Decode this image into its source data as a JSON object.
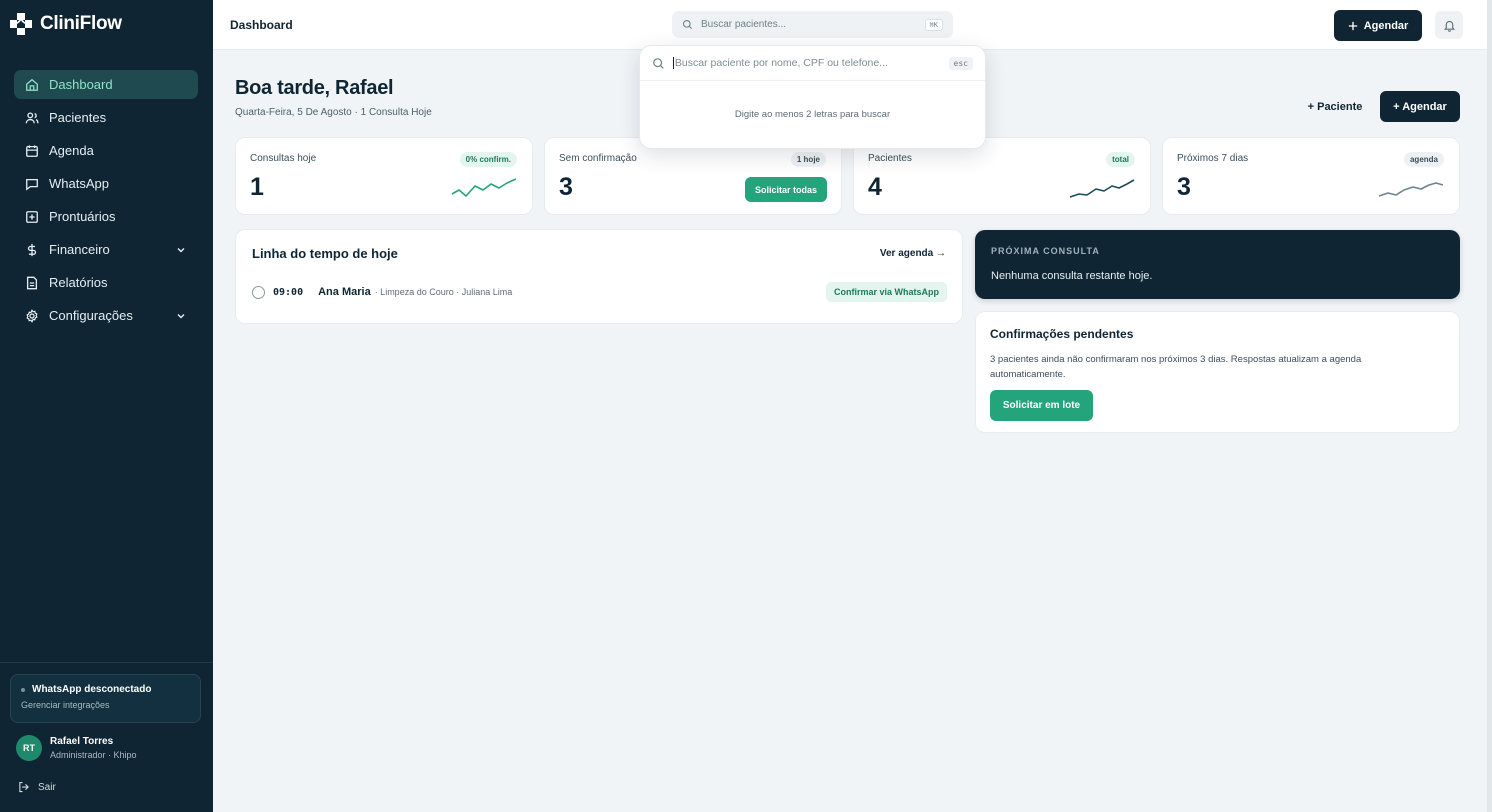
{
  "brand": {
    "name": "CliniFlow"
  },
  "sidebar": {
    "items": [
      {
        "label": "Dashboard",
        "icon": "home-icon"
      },
      {
        "label": "Pacientes",
        "icon": "users-icon"
      },
      {
        "label": "Agenda",
        "icon": "calendar-icon"
      },
      {
        "label": "WhatsApp",
        "icon": "chat-icon"
      },
      {
        "label": "Prontuários",
        "icon": "plus-square-icon"
      },
      {
        "label": "Financeiro",
        "icon": "dollar-icon"
      },
      {
        "label": "Relatórios",
        "icon": "file-icon"
      },
      {
        "label": "Configurações",
        "icon": "gear-icon"
      }
    ],
    "whatsapp_status": {
      "title": "WhatsApp desconectado",
      "link": "Gerenciar integrações"
    },
    "user": {
      "initials": "RT",
      "name": "Rafael Torres",
      "role": "Administrador · Khipo"
    },
    "logout": "Sair"
  },
  "topbar": {
    "breadcrumb": "Dashboard",
    "search_placeholder": "Buscar pacientes...",
    "search_shortcut": "⌘K",
    "agendar_label": "Agendar"
  },
  "header": {
    "greeting": "Boa tarde, Rafael",
    "subtitle": "Quarta-Feira, 5 De Agosto · 1 Consulta Hoje",
    "paciente_label": "+ Paciente",
    "agendar_label": "+ Agendar"
  },
  "stats": [
    {
      "label": "Consultas hoje",
      "value": "1",
      "badge": "0% confirm."
    },
    {
      "label": "Sem confirmação",
      "value": "3",
      "badge": "1 hoje",
      "action": "Solicitar todas"
    },
    {
      "label": "Pacientes",
      "value": "4",
      "badge": "total"
    },
    {
      "label": "Próximos 7 dias",
      "value": "3",
      "badge": "agenda"
    }
  ],
  "timeline": {
    "title": "Linha do tempo de hoje",
    "link": "Ver agenda →",
    "rows": [
      {
        "time": "09:00",
        "patient": "Ana Maria",
        "details": "· Limpeza do Couro · Juliana Lima",
        "action": "Confirmar via WhatsApp"
      }
    ]
  },
  "next_appointment": {
    "title": "PRÓXIMA CONSULTA",
    "message": "Nenhuma consulta restante hoje."
  },
  "pending": {
    "title": "Confirmações pendentes",
    "description": "3 pacientes ainda não confirmaram nos próximos 3 dias. Respostas atualizam a agenda automaticamente.",
    "action": "Solicitar em lote"
  },
  "search_dropdown": {
    "placeholder": "Buscar paciente por nome, CPF ou telefone...",
    "esc": "esc",
    "hint": "Digite ao menos 2 letras para buscar"
  },
  "colors": {
    "sidebar": "#0f2533",
    "accent": "#23a47a",
    "active_nav": "#1f4a4f"
  }
}
